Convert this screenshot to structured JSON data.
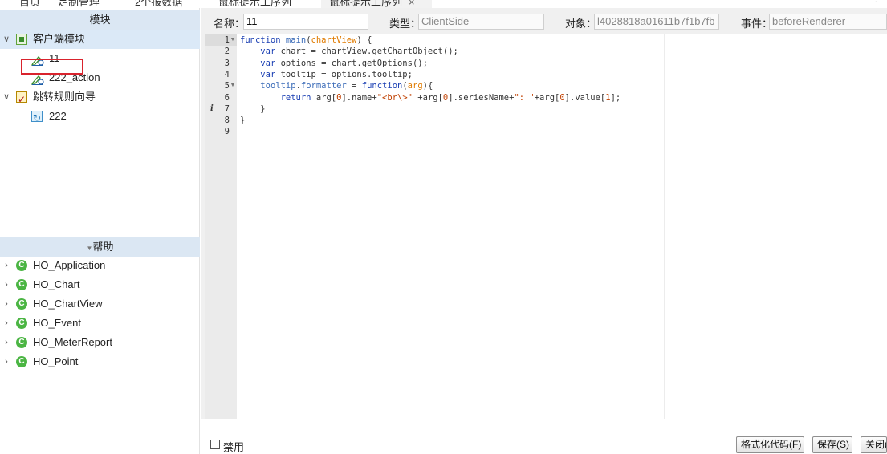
{
  "tabs": [
    {
      "label": "首页"
    },
    {
      "label": "定制管理"
    },
    {
      "label": "2个报数据"
    },
    {
      "label": "鼠标提示工序列"
    },
    {
      "label": "鼠标提示工序列",
      "active": true,
      "close": "×"
    }
  ],
  "left_panel": {
    "modules_header": "模块",
    "tree": [
      {
        "label": "客户端模块",
        "icon": "client-module-icon",
        "expanded": true
      },
      {
        "label": "11",
        "icon": "script-edit-icon",
        "selected": true
      },
      {
        "label": "222_action",
        "icon": "script-edit-icon"
      },
      {
        "label": "跳转规则向导",
        "icon": "rule-wizard-icon",
        "expanded": true
      },
      {
        "label": "222",
        "icon": "redirect-icon"
      }
    ],
    "help_header": "帮助",
    "help_items": [
      {
        "label": "HO_Application",
        "icon": "class-c-icon"
      },
      {
        "label": "HO_Chart",
        "icon": "class-c-icon"
      },
      {
        "label": "HO_ChartView",
        "icon": "class-c-icon"
      },
      {
        "label": "HO_Event",
        "icon": "class-c-icon"
      },
      {
        "label": "HO_MeterReport",
        "icon": "class-c-icon"
      },
      {
        "label": "HO_Point",
        "icon": "class-c-icon"
      }
    ]
  },
  "props": {
    "name_label": "名称：",
    "name_value": "11",
    "type_label": "类型：",
    "type_value": "ClientSide",
    "object_label": "对象：",
    "object_value": "l4028818a01611b7f1b7fb",
    "event_label": "事件：",
    "event_value": "beforeRenderer"
  },
  "editor": {
    "line_numbers": [
      "1",
      "2",
      "3",
      "4",
      "5",
      "6",
      "7",
      "8",
      "9"
    ],
    "info_mark_line": "7"
  },
  "bottom": {
    "disable_label": "禁用",
    "format_button": "格式化代码(F)",
    "save_button": "保存(S)",
    "close_button": "关闭(C)"
  },
  "colors": {
    "keyword": "#1a3fb3",
    "param": "#e07b00",
    "string": "#c04000",
    "selection_border": "#d9232d",
    "header_bg": "#dbe7f3",
    "help_icon": "#4bb543"
  }
}
